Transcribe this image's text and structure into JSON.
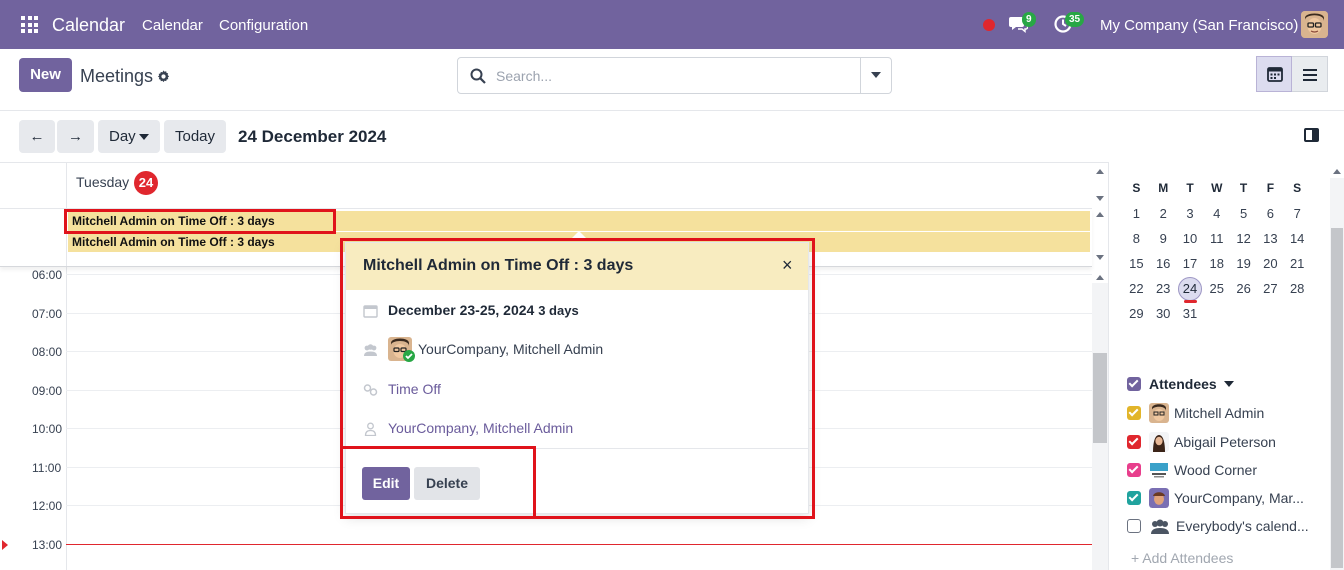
{
  "navbar": {
    "app_name": "Calendar",
    "menu": [
      "Calendar",
      "Configuration"
    ],
    "messages_count": "9",
    "activities_count": "35",
    "company": "My Company (San Francisco)",
    "colors": {
      "bar": "#71639e",
      "status_dot": "#e0272e",
      "badge": "#28a745"
    }
  },
  "control_panel": {
    "new_label": "New",
    "breadcrumb": "Meetings",
    "search_placeholder": "Search...",
    "view_buttons": [
      "calendar-icon",
      "list-icon"
    ]
  },
  "toolbar": {
    "prev": "←",
    "next": "→",
    "scale": "Day",
    "today": "Today",
    "date_title": "24 December 2024"
  },
  "calendar": {
    "day_name": "Tuesday",
    "day_number": "24",
    "allday_events": [
      "Mitchell Admin on Time Off : 3 days",
      "Mitchell Admin on Time Off : 3 days"
    ],
    "hours": [
      "06:00",
      "07:00",
      "08:00",
      "09:00",
      "10:00",
      "11:00",
      "12:00",
      "13:00"
    ],
    "event_color": "#f5e19d"
  },
  "popover": {
    "title": "Mitchell Admin on Time Off : 3 days",
    "close": "×",
    "date_range": "December 23-25, 2024",
    "duration": "3 days",
    "attendees": "YourCompany, Mitchell Admin",
    "tag": "Time Off",
    "organizer": "YourCompany, Mitchell Admin",
    "edit_label": "Edit",
    "delete_label": "Delete"
  },
  "mini_calendar": {
    "weekdays": [
      "S",
      "M",
      "T",
      "W",
      "T",
      "F",
      "S"
    ],
    "weeks": [
      [
        "1",
        "2",
        "3",
        "4",
        "5",
        "6",
        "7"
      ],
      [
        "8",
        "9",
        "10",
        "11",
        "12",
        "13",
        "14"
      ],
      [
        "15",
        "16",
        "17",
        "18",
        "19",
        "20",
        "21"
      ],
      [
        "22",
        "23",
        "24",
        "25",
        "26",
        "27",
        "28"
      ],
      [
        "29",
        "30",
        "31",
        "",
        "",
        "",
        ""
      ]
    ],
    "selected": "24"
  },
  "filters": {
    "title": "Attendees",
    "items": [
      {
        "name": "Mitchell Admin",
        "checked": true,
        "color": "#e2b52a"
      },
      {
        "name": "Abigail Peterson",
        "checked": true,
        "color": "#e0272e"
      },
      {
        "name": "Wood Corner",
        "checked": true,
        "color": "#e83e8c"
      },
      {
        "name": "YourCompany, Mar...",
        "checked": true,
        "color": "#20a39e"
      },
      {
        "name": "Everybody's calend...",
        "checked": false,
        "color": "#ffffff"
      }
    ],
    "add_label": "+ Add Attendees",
    "title_checkbox_color": "#71639e"
  }
}
